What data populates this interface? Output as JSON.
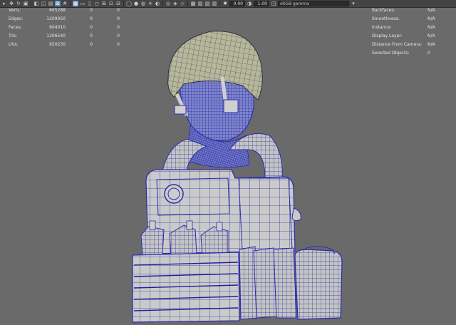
{
  "toolbar": {
    "icons": [
      "select-icon",
      "move-icon",
      "rotate-icon",
      "scale-icon",
      "wireframe-icon",
      "shaded-icon",
      "textured-icon",
      "light-icon",
      "shadow-icon",
      "isolate-icon",
      "grid-icon",
      "xray-icon",
      "camera-icon",
      "film-gate-icon",
      "resolution-gate-icon",
      "safe-area-icon",
      "exposure-icon",
      "gamma-icon"
    ],
    "exposure_value": "0.00",
    "gamma_value": "1.00",
    "color_space": "sRGB gamma"
  },
  "hud_left": {
    "rows": [
      {
        "label": "Verts:",
        "v1": "605288",
        "v2": "0",
        "v3": "0"
      },
      {
        "label": "Edges:",
        "v1": "1209050",
        "v2": "0",
        "v3": "0"
      },
      {
        "label": "Faces:",
        "v1": "604010",
        "v2": "0",
        "v3": "0"
      },
      {
        "label": "Tris:",
        "v1": "1206540",
        "v2": "0",
        "v3": "0"
      },
      {
        "label": "UVs:",
        "v1": "650230",
        "v2": "0",
        "v3": "0"
      }
    ]
  },
  "hud_right": {
    "rows": [
      {
        "label": "Backfaces:",
        "value": "N/A"
      },
      {
        "label": "Smoothness:",
        "value": "N/A"
      },
      {
        "label": "Instance:",
        "value": "N/A"
      },
      {
        "label": "Display Layer:",
        "value": "N/A"
      },
      {
        "label": "Distance From Camera:",
        "value": "N/A"
      },
      {
        "label": "Selected Objects:",
        "value": "0"
      }
    ]
  },
  "colors": {
    "background": "#6a6a6a",
    "wire_blue": "#2b2bb0",
    "mesh_fill": "#c8c8c8",
    "toolbar": "#444444"
  }
}
